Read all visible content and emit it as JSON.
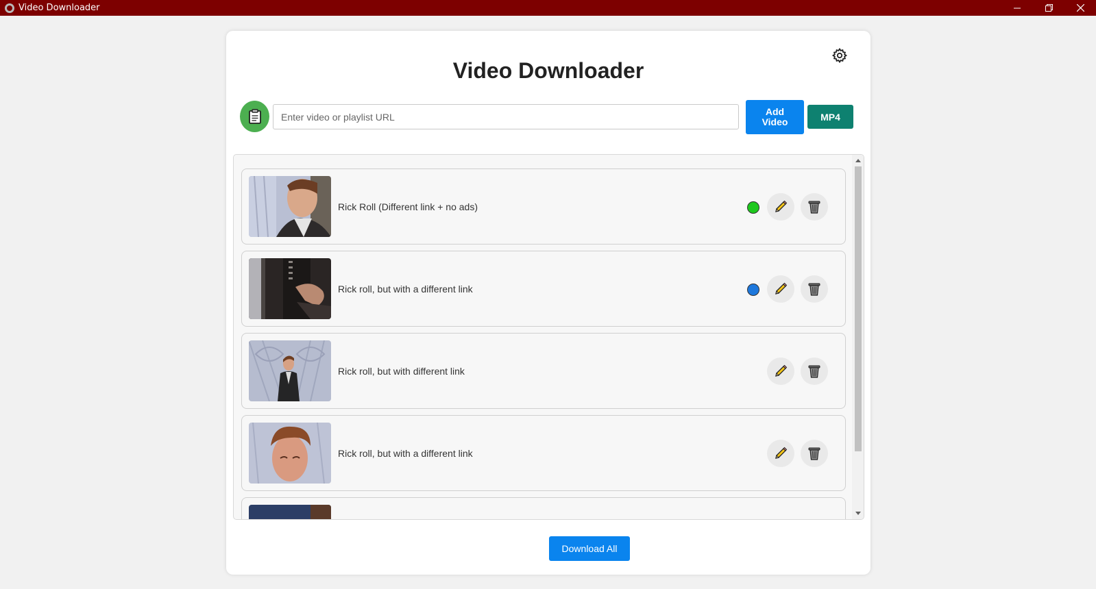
{
  "window": {
    "title": "Video Downloader",
    "titlebar_color": "#7d0000"
  },
  "app": {
    "heading": "Video Downloader",
    "settings_icon": "gear-icon",
    "paste_icon": "clipboard-icon",
    "url_placeholder": "Enter video or playlist URL",
    "url_value": "",
    "add_button": "Add Video",
    "format_button": "MP4",
    "download_all_button": "Download All"
  },
  "videos": [
    {
      "title": "Rick Roll (Different link + no ads)",
      "status": "green"
    },
    {
      "title": "Rick roll, but with a different link",
      "status": "blue"
    },
    {
      "title": "Rick roll, but with different link",
      "status": ""
    },
    {
      "title": "Rick roll, but with a different link",
      "status": ""
    }
  ],
  "colors": {
    "status_green": "#1ec81e",
    "status_blue": "#1e78dc",
    "primary_button": "#0a84ee",
    "format_button": "#0e8170",
    "paste_button": "#4caf50"
  }
}
